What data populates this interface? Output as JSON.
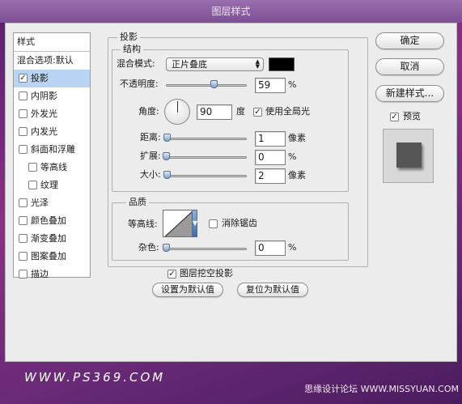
{
  "window": {
    "title": "图层样式"
  },
  "sidebar": {
    "header": "样式",
    "blend_options": "混合选项:默认",
    "items": [
      {
        "label": "投影",
        "checked": true,
        "active": true
      },
      {
        "label": "内阴影",
        "checked": false
      },
      {
        "label": "外发光",
        "checked": false
      },
      {
        "label": "内发光",
        "checked": false
      },
      {
        "label": "斜面和浮雕",
        "checked": false
      },
      {
        "label": "等高线",
        "checked": false
      },
      {
        "label": "纹理",
        "checked": false
      },
      {
        "label": "光泽",
        "checked": false
      },
      {
        "label": "颜色叠加",
        "checked": false
      },
      {
        "label": "渐变叠加",
        "checked": false
      },
      {
        "label": "图案叠加",
        "checked": false
      },
      {
        "label": "描边",
        "checked": false
      }
    ]
  },
  "drop_shadow": {
    "title": "投影",
    "structure": {
      "title": "结构",
      "blend_mode_label": "混合模式:",
      "blend_mode_value": "正片叠底",
      "shadow_color": "#000000",
      "opacity_label": "不透明度:",
      "opacity_value": "59",
      "opacity_unit": "%",
      "opacity_fraction": 0.59,
      "angle_label": "角度:",
      "angle_value": "90",
      "angle_unit": "度",
      "global_light_label": "使用全局光",
      "global_light_checked": true,
      "distance_label": "距离:",
      "distance_value": "1",
      "distance_unit": "像素",
      "spread_label": "扩展:",
      "spread_value": "0",
      "spread_unit": "%",
      "size_label": "大小:",
      "size_value": "2",
      "size_unit": "像素"
    },
    "quality": {
      "title": "品质",
      "contour_label": "等高线:",
      "anti_alias_label": "消除锯齿",
      "anti_alias_checked": false,
      "noise_label": "杂色:",
      "noise_value": "0",
      "noise_unit": "%"
    },
    "knockout_label": "图层挖空投影",
    "knockout_checked": true,
    "make_default_label": "设置为默认值",
    "reset_default_label": "复位为默认值"
  },
  "actions": {
    "ok": "确定",
    "cancel": "取消",
    "new_style": "新建样式...",
    "preview_label": "预览",
    "preview_checked": true
  },
  "watermark": {
    "left": "WWW.PS369.COM",
    "right": "思缘设计论坛 WWW.MISSYUAN.COM"
  }
}
